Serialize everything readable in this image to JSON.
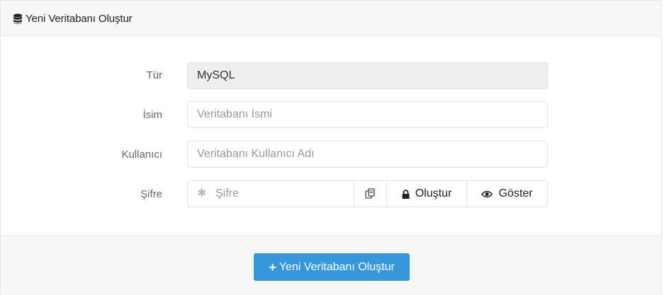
{
  "panel": {
    "title": "Yeni Veritabanı Oluştur",
    "icon": "database-icon"
  },
  "form": {
    "type": {
      "label": "Tür",
      "value": "MySQL"
    },
    "name": {
      "label": "İsim",
      "placeholder": "Veritabanı İsmi",
      "value": ""
    },
    "user": {
      "label": "Kullanıcı",
      "placeholder": "Veritabanı Kullanıcı Adı",
      "value": ""
    },
    "password": {
      "label": "Şifre",
      "placeholder": "Şifre",
      "value": "",
      "copy_icon": "copy-icon",
      "generate_label": "Oluştur",
      "generate_icon": "lock-icon",
      "show_label": "Göster",
      "show_icon": "eye-icon"
    }
  },
  "footer": {
    "submit_label": "Yeni Veritabanı Oluştur",
    "submit_icon": "plus-icon"
  },
  "colors": {
    "primary": "#3498db",
    "heading_bg": "#f7f7f7",
    "readonly_bg": "#eeeeee"
  }
}
